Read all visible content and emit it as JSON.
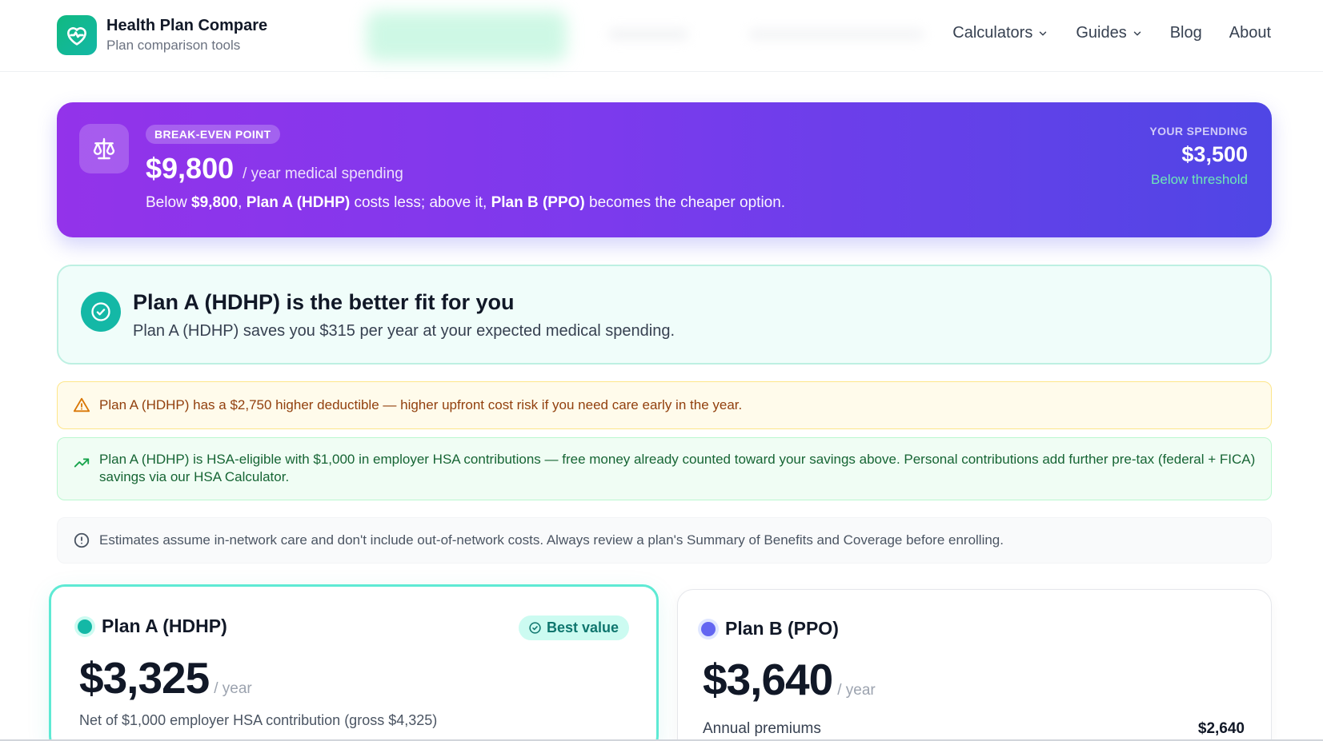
{
  "brand": {
    "title": "Health Plan Compare",
    "subtitle": "Plan comparison tools",
    "logo_icon": "heart-pulse-icon"
  },
  "nav": {
    "calculators": "Calculators",
    "guides": "Guides",
    "blog": "Blog",
    "about": "About"
  },
  "breakeven": {
    "badge": "BREAK-EVEN POINT",
    "amount": "$9,800",
    "unit": "/ year medical spending",
    "desc": {
      "p1": "Below ",
      "amount": "$9,800",
      "p2": ", ",
      "plan_a": "Plan A (HDHP)",
      "p3": " costs less; above it, ",
      "plan_b": "Plan B (PPO)",
      "p4": " becomes the cheaper option."
    },
    "your_spending_label": "YOUR SPENDING",
    "your_spending_value": "$3,500",
    "your_spending_status": "Below threshold",
    "icon": "scale-icon"
  },
  "recommendation": {
    "title": "Plan A (HDHP) is the better fit for you",
    "subtitle": "Plan A (HDHP) saves you $315 per year at your expected medical spending.",
    "icon": "check-circle-icon"
  },
  "alerts": {
    "deductible": "Plan A (HDHP) has a $2,750 higher deductible — higher upfront cost risk if you need care early in the year.",
    "hsa": "Plan A (HDHP) is HSA-eligible with $1,000 in employer HSA contributions — free money already counted toward your savings above. Personal contributions add further pre-tax (federal + FICA) savings via our HSA Calculator.",
    "disclaimer": "Estimates assume in-network care and don't include out-of-network costs. Always review a plan's Summary of Benefits and Coverage before enrolling."
  },
  "plans": [
    {
      "name": "Plan A (HDHP)",
      "badge": "Best value",
      "price": "$3,325",
      "unit": "/ year",
      "note": "Net of $1,000 employer HSA contribution (gross $4,325)",
      "color": "#14b8a6"
    },
    {
      "name": "Plan B (PPO)",
      "price": "$3,640",
      "unit": "/ year",
      "row_label": "Annual premiums",
      "row_value": "$2,640",
      "color": "#6366f1"
    }
  ],
  "colors": {
    "accent": "#14b8a6",
    "banner_start": "#9333ea",
    "banner_end": "#4f46e5"
  }
}
